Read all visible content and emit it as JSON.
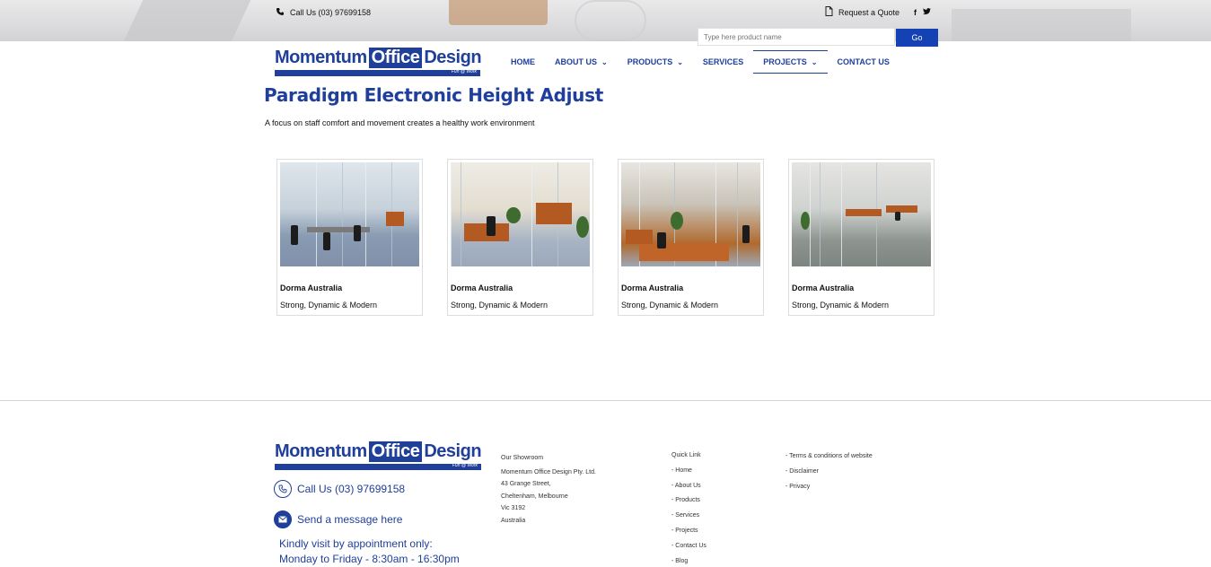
{
  "topbar": {
    "phone": "Call Us (03) 97699158",
    "quote": "Request a Quote",
    "search_placeholder": "Type here product name",
    "go_label": "Go"
  },
  "brand": {
    "word1": "Momentum",
    "word2": "Office",
    "word3": "Design",
    "tagline": "Fun @ Work"
  },
  "nav": [
    {
      "label": "HOME"
    },
    {
      "label": "ABOUT US"
    },
    {
      "label": "PRODUCTS"
    },
    {
      "label": "SERVICES"
    },
    {
      "label": "PROJECTS"
    },
    {
      "label": "CONTACT US"
    }
  ],
  "page": {
    "title": "Paradigm Electronic Height Adjust",
    "subtitle": "A focus on staff comfort and movement creates a healthy work environment"
  },
  "cards": [
    {
      "name": "Dorma Australia",
      "desc": "Strong, Dynamic & Modern"
    },
    {
      "name": "Dorma Australia",
      "desc": "Strong, Dynamic & Modern"
    },
    {
      "name": "Dorma Australia",
      "desc": "Strong, Dynamic & Modern"
    },
    {
      "name": "Dorma Australia",
      "desc": "Strong, Dynamic & Modern"
    }
  ],
  "footer": {
    "phone": "Call Us (03) 97699158",
    "message": "Send a message here",
    "visit_line1": "Kindly visit by appointment only:",
    "visit_line2": "Monday to Friday - 8:30am - 16:30pm",
    "showroom": {
      "heading": "Our Showroom",
      "lines": [
        "Momentum Office Design Pty. Ltd.",
        "43 Grange Street,",
        "Cheltenham, Melbourne",
        "Vic 3192",
        "Australia"
      ]
    },
    "quick_link": {
      "heading": "Quick Link",
      "items": [
        "- Home",
        "- About Us",
        "- Products",
        "- Services",
        "- Projects",
        "- Contact Us",
        "- Blog"
      ]
    },
    "legal": [
      "- Terms & conditions of website",
      "- Disclaimer",
      "- Privacy"
    ]
  },
  "colors": {
    "brand_blue": "#1f3f9b",
    "button_blue": "#1441b3"
  }
}
